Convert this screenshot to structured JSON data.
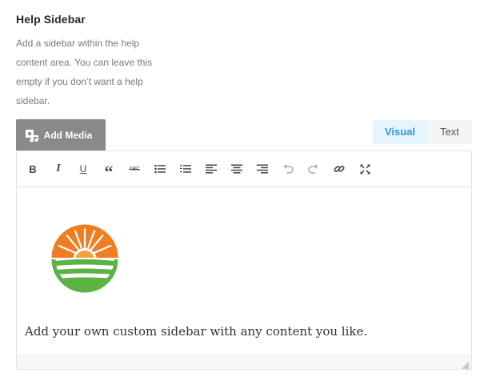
{
  "section": {
    "title": "Help Sidebar",
    "description": "Add a sidebar within the help\ncontent area. You can leave this\nempty if you don’t want a help\nsidebar."
  },
  "media": {
    "add_media_label": "Add Media",
    "icon": "add-media-icon"
  },
  "tabs": {
    "visual": "Visual",
    "text": "Text"
  },
  "toolbar": {
    "bold": "B",
    "italic": "I",
    "underline": "U",
    "blockquote": "“",
    "strikethrough": "ABC",
    "icons": [
      "bold-icon",
      "italic-icon",
      "underline-icon",
      "blockquote-icon",
      "strikethrough-icon",
      "bullet-list-icon",
      "numbered-list-icon",
      "align-left-icon",
      "align-center-icon",
      "align-right-icon",
      "undo-icon",
      "redo-icon",
      "link-icon",
      "fullscreen-icon"
    ]
  },
  "content": {
    "paragraph": "Add your own custom sidebar with any content you like.",
    "image": "sun-field-logo"
  },
  "colors": {
    "accent": "#2b9bd5",
    "button_bg": "#8a8a8a",
    "logo_orange": "#ef7d22",
    "logo_green": "#5cb245"
  }
}
